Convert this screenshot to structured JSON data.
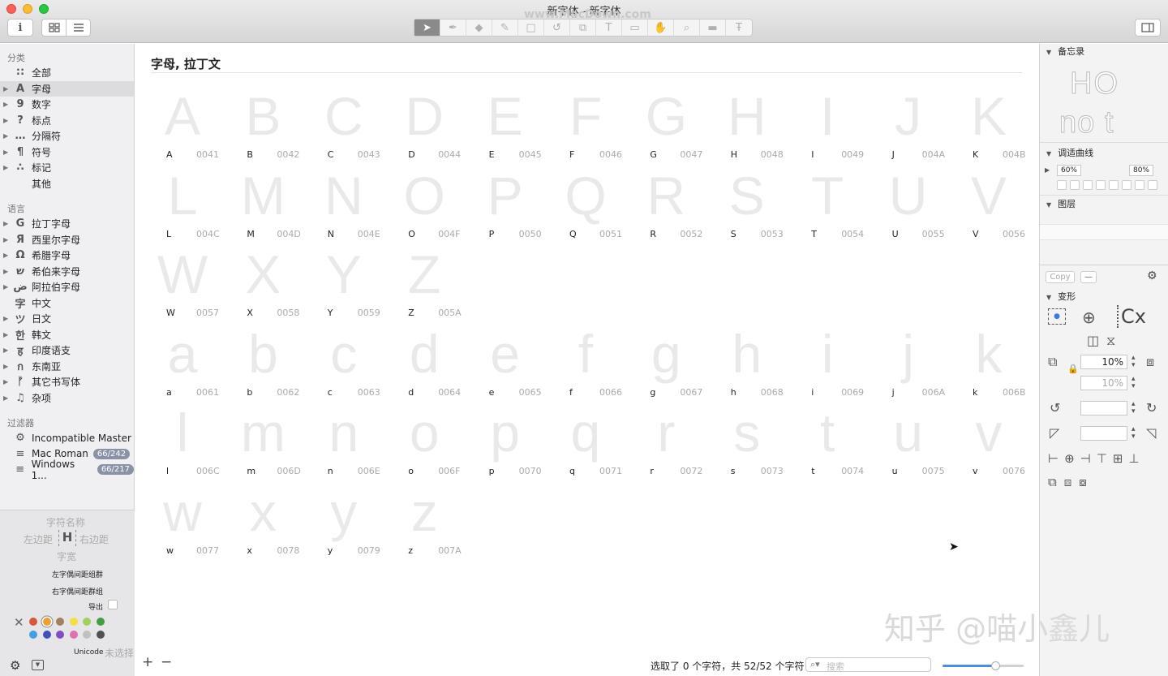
{
  "window": {
    "title": "新字体 - 新字体",
    "watermark_text": "www.MacDown.com"
  },
  "toolbar": {
    "info_icon": "i",
    "view_grid": "grid-view-icon",
    "view_list": "list-view-icon",
    "tools": [
      "select-tool",
      "pen-tool",
      "eraser-tool",
      "knife-tool",
      "rect-tool",
      "rotate-tool",
      "scale-tool",
      "text-tool",
      "annotation-tool",
      "hand-tool",
      "zoom-tool",
      "measure-tool",
      "type-tool"
    ]
  },
  "sidebar": {
    "categories_header": "分类",
    "categories": [
      {
        "icon": "∷",
        "label": "全部",
        "arrow": false
      },
      {
        "icon": "A",
        "label": "字母",
        "arrow": true,
        "selected": true
      },
      {
        "icon": "9",
        "label": "数字",
        "arrow": true
      },
      {
        "icon": "?",
        "label": "标点",
        "arrow": true
      },
      {
        "icon": "…",
        "label": "分隔符",
        "arrow": true
      },
      {
        "icon": "¶",
        "label": "符号",
        "arrow": true
      },
      {
        "icon": "∴",
        "label": "标记",
        "arrow": true
      },
      {
        "icon": "",
        "label": "其他",
        "arrow": false
      }
    ],
    "languages_header": "语言",
    "languages": [
      {
        "icon": "G",
        "label": "拉丁字母"
      },
      {
        "icon": "Я",
        "label": "西里尔字母"
      },
      {
        "icon": "Ω",
        "label": "希腊字母"
      },
      {
        "icon": "ש",
        "label": "希伯来字母"
      },
      {
        "icon": "ض",
        "label": "阿拉伯字母"
      },
      {
        "icon": "字",
        "label": "中文",
        "noarrow": true
      },
      {
        "icon": "ツ",
        "label": "日文"
      },
      {
        "icon": "한",
        "label": "韩文"
      },
      {
        "icon": "ह",
        "label": "印度语支"
      },
      {
        "icon": "ก",
        "label": "东南亚"
      },
      {
        "icon": "ᚠ",
        "label": "其它书写体"
      },
      {
        "icon": "♫",
        "label": "杂项"
      }
    ],
    "filters_header": "过滤器",
    "filters": [
      {
        "icon": "⚙",
        "label": "Incompatible Master",
        "badge": ""
      },
      {
        "icon": "≡",
        "label": "Mac Roman",
        "badge": "66/242"
      },
      {
        "icon": "≡",
        "label": "Windows 1...",
        "badge": "66/217"
      }
    ]
  },
  "info_panel": {
    "glyph_name": "字符名称",
    "left_sb": "左边距",
    "right_sb": "右边距",
    "width": "字宽",
    "left_kern": "左字偶间距组群",
    "right_kern": "右字偶间距群组",
    "export": "导出",
    "unicode_label": "Unicode",
    "unicode_value": "未选择",
    "colors": [
      "#d9573b",
      "#f0a030",
      "#a08060",
      "#f0e040",
      "#a0d060",
      "#40a040",
      "#40a0e0",
      "#4050c0",
      "#8050c0",
      "#e070b0",
      "#c0c0c0",
      "#505050"
    ]
  },
  "main": {
    "section_title": "字母, 拉丁文",
    "glyphs": [
      [
        "A",
        "0041"
      ],
      [
        "B",
        "0042"
      ],
      [
        "C",
        "0043"
      ],
      [
        "D",
        "0044"
      ],
      [
        "E",
        "0045"
      ],
      [
        "F",
        "0046"
      ],
      [
        "G",
        "0047"
      ],
      [
        "H",
        "0048"
      ],
      [
        "I",
        "0049"
      ],
      [
        "J",
        "004A"
      ],
      [
        "K",
        "004B"
      ],
      [
        "L",
        "004C"
      ],
      [
        "M",
        "004D"
      ],
      [
        "N",
        "004E"
      ],
      [
        "O",
        "004F"
      ],
      [
        "P",
        "0050"
      ],
      [
        "Q",
        "0051"
      ],
      [
        "R",
        "0052"
      ],
      [
        "S",
        "0053"
      ],
      [
        "T",
        "0054"
      ],
      [
        "U",
        "0055"
      ],
      [
        "V",
        "0056"
      ],
      [
        "W",
        "0057"
      ],
      [
        "X",
        "0058"
      ],
      [
        "Y",
        "0059"
      ],
      [
        "Z",
        "005A"
      ],
      [
        "a",
        "0061"
      ],
      [
        "b",
        "0062"
      ],
      [
        "c",
        "0063"
      ],
      [
        "d",
        "0064"
      ],
      [
        "e",
        "0065"
      ],
      [
        "f",
        "0066"
      ],
      [
        "g",
        "0067"
      ],
      [
        "h",
        "0068"
      ],
      [
        "i",
        "0069"
      ],
      [
        "j",
        "006A"
      ],
      [
        "k",
        "006B"
      ],
      [
        "l",
        "006C"
      ],
      [
        "m",
        "006D"
      ],
      [
        "n",
        "006E"
      ],
      [
        "o",
        "006F"
      ],
      [
        "p",
        "0070"
      ],
      [
        "q",
        "0071"
      ],
      [
        "r",
        "0072"
      ],
      [
        "s",
        "0073"
      ],
      [
        "t",
        "0074"
      ],
      [
        "u",
        "0075"
      ],
      [
        "v",
        "0076"
      ],
      [
        "w",
        "0077"
      ],
      [
        "x",
        "0078"
      ],
      [
        "y",
        "0079"
      ],
      [
        "z",
        "007A"
      ]
    ],
    "rows": [
      11,
      11,
      4,
      11,
      11,
      4
    ],
    "status": "选取了 0 个字符，共 52/52 个字符",
    "search_placeholder": "搜索",
    "add_label": "+",
    "remove_label": "−",
    "zoom_level": 0.65
  },
  "right_panel": {
    "notes_header": "备忘录",
    "preview_text_1": "HO",
    "preview_text_2": "no t",
    "curve_header": "调适曲线",
    "curve_val1": "60%",
    "curve_val2": "80%",
    "layers_header": "图层",
    "copy_label": "Copy",
    "transform_header": "变形",
    "cx_label": "Cx",
    "scale_x": "10%",
    "scale_y": "10%",
    "rotate": "",
    "slant": ""
  },
  "overlay": {
    "zhihu_watermark": "知乎 @喵小鑫儿"
  }
}
